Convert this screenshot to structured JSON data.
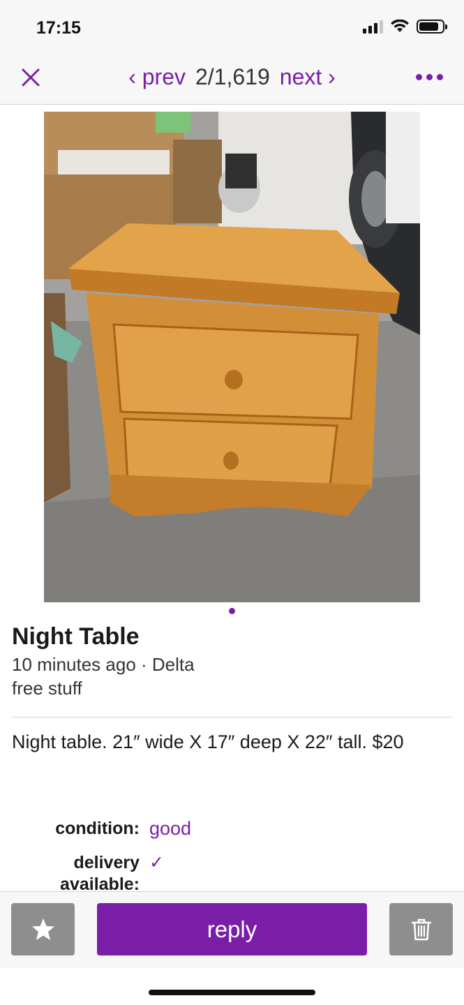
{
  "status_bar": {
    "time": "17:15",
    "battery_level": 0.85,
    "signal_bars": 3
  },
  "nav": {
    "prev_label": "‹ prev",
    "position": "2/1,619",
    "next_label": "next ›"
  },
  "post": {
    "title": "Night Table",
    "meta": "10 minutes ago · Delta",
    "category": "free stuff",
    "description": "Night table. 21″ wide X 17″ deep X 22″ tall. $20",
    "attributes": [
      {
        "label": "condition:",
        "value": "good"
      },
      {
        "label": "delivery available:",
        "value": "✓"
      }
    ]
  },
  "images": {
    "count": 1,
    "current": 1
  },
  "toolbar": {
    "reply_label": "reply"
  },
  "colors": {
    "accent": "#7a1ea8",
    "button_gray": "#8e8e8e"
  },
  "icons": [
    "close-icon",
    "more-icon",
    "star-icon",
    "trash-icon"
  ]
}
